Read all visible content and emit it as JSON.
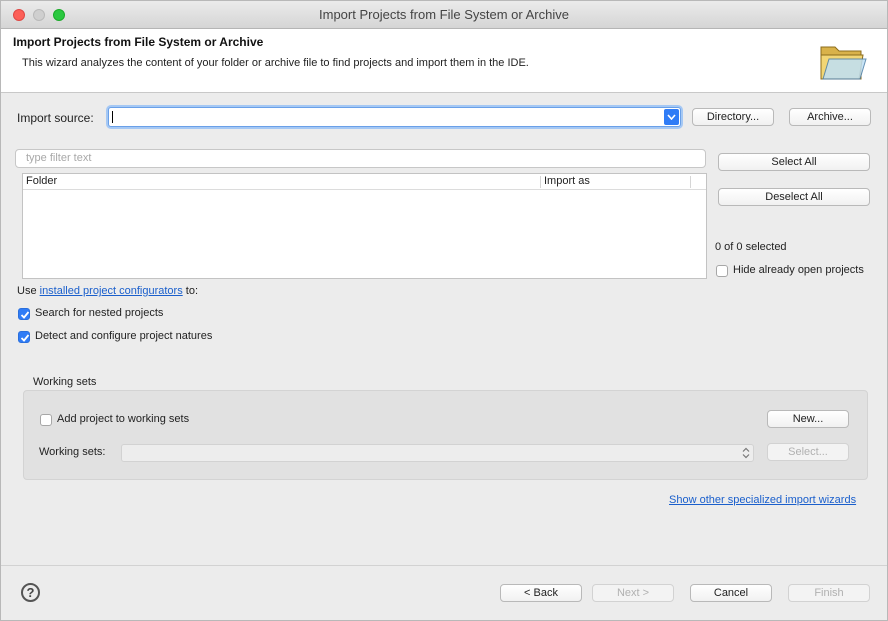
{
  "window": {
    "title": "Import Projects from File System or Archive"
  },
  "banner": {
    "title": "Import Projects from File System or Archive",
    "description": "This wizard analyzes the content of your folder or archive file to find projects and import them in the IDE.",
    "icon": "folder-icon"
  },
  "import_source": {
    "label": "Import source:",
    "value": "",
    "directory_button": "Directory...",
    "archive_button": "Archive..."
  },
  "filter": {
    "placeholder": "type filter text"
  },
  "table": {
    "columns": [
      "Folder",
      "Import as"
    ],
    "rows": []
  },
  "selection": {
    "select_all": "Select All",
    "deselect_all": "Deselect All",
    "count_text": "0 of 0 selected",
    "hide_open_label": "Hide already open projects",
    "hide_open_checked": false
  },
  "configurators": {
    "prefix": "Use",
    "link_text": "installed project configurators",
    "suffix": "to:",
    "options": [
      {
        "label": "Search for nested projects",
        "checked": true
      },
      {
        "label": "Detect and configure project natures",
        "checked": true
      }
    ]
  },
  "working_sets": {
    "group_title": "Working sets",
    "add_label": "Add project to working sets",
    "add_checked": false,
    "new_button": "New...",
    "sets_label": "Working sets:",
    "sets_value": "",
    "select_button": "Select..."
  },
  "footer": {
    "other_wizards_link": "Show other specialized import wizards",
    "help_symbol": "?",
    "back": "< Back",
    "next": "Next >",
    "cancel": "Cancel",
    "finish": "Finish"
  },
  "colors": {
    "accent": "#2f7cf6",
    "link": "#1a5fcc"
  }
}
